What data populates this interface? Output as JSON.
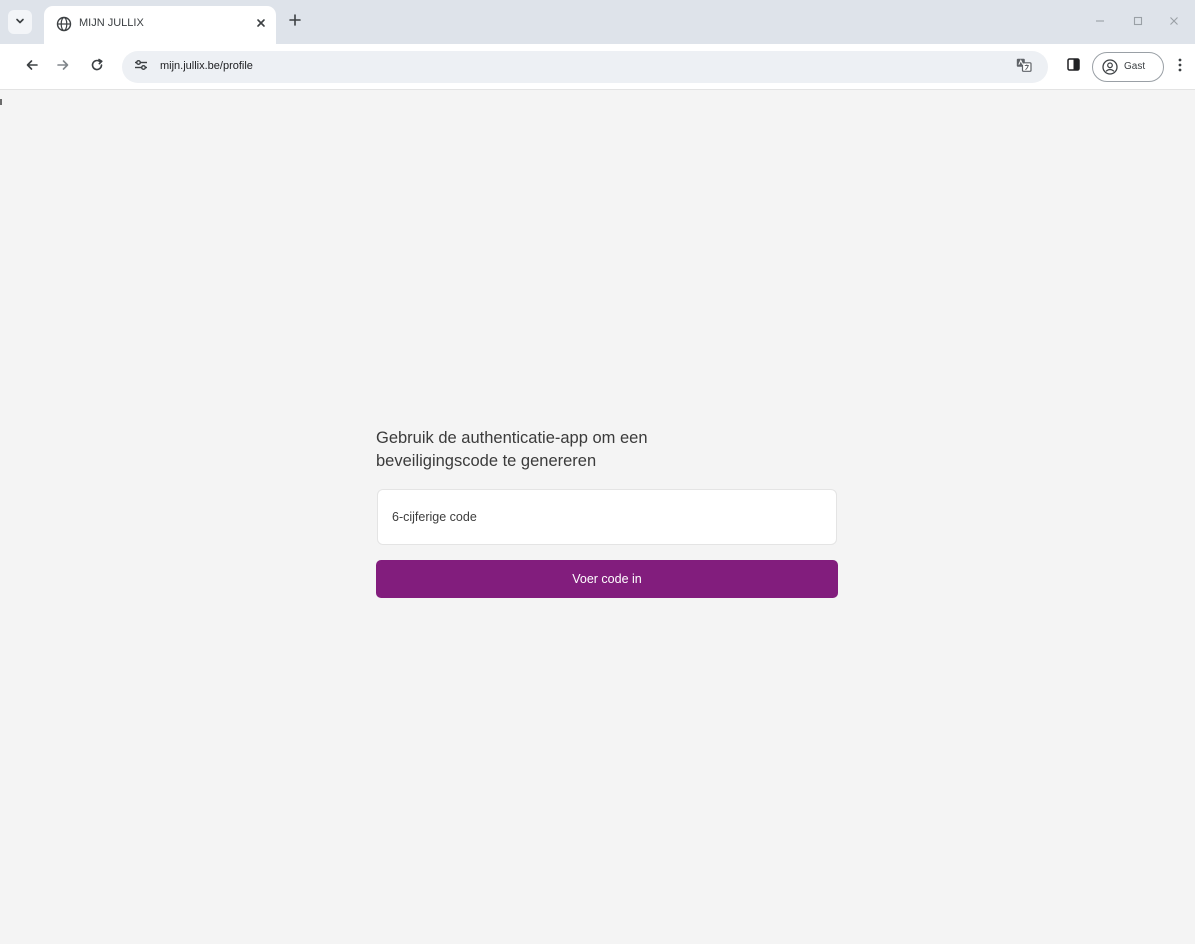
{
  "browser": {
    "tab": {
      "title": "MIJN JULLIX",
      "favicon": "globe-icon"
    },
    "address_bar": {
      "url": "mijn.jullix.be/profile"
    },
    "profile": {
      "label": "Gast"
    },
    "icons": {
      "tab_list": "chevron-down-icon",
      "close_tab": "close-icon",
      "new_tab": "plus-icon",
      "back": "arrow-left-icon",
      "forward": "arrow-right-icon",
      "reload": "reload-icon",
      "site_info": "tune-icon",
      "translate": "translate-icon",
      "side_panel": "side-panel-icon",
      "menu": "more-vertical-icon",
      "minimize": "minimize-icon",
      "maximize": "maximize-icon",
      "close_window": "close-icon"
    }
  },
  "auth": {
    "heading": "Gebruik de authenticatie-app om een beveiligingscode te genereren",
    "code_input": {
      "value": "",
      "placeholder": "6-cijferige code"
    },
    "submit_label": "Voer code in"
  },
  "colors": {
    "accent": "#821d7d",
    "page_background": "#f4f4f4",
    "tabstrip": "#dee3ea"
  }
}
